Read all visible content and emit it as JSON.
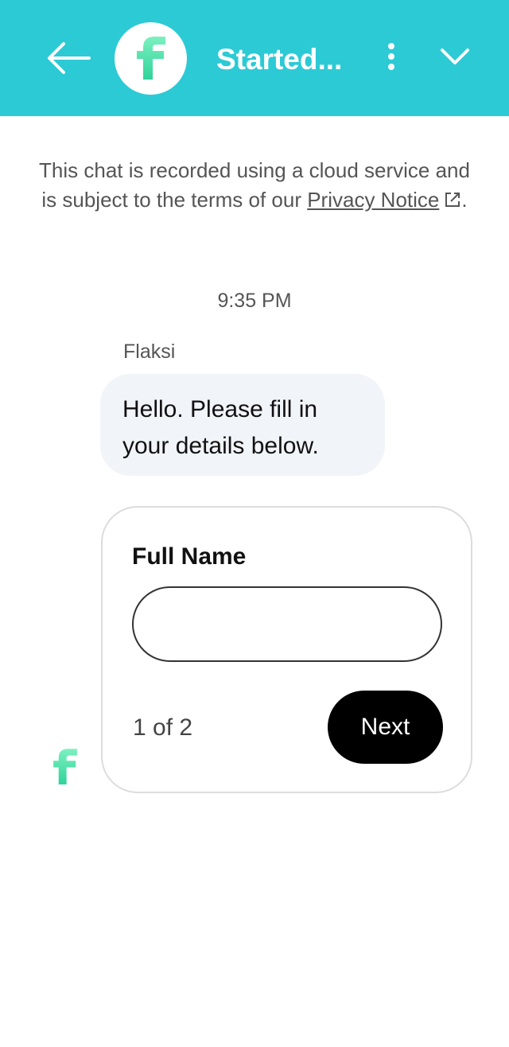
{
  "header": {
    "title": "Started...",
    "back_icon": "arrow-left-icon",
    "more_icon": "more-vertical-icon",
    "collapse_icon": "chevron-down-icon",
    "brand_color": "#2ccad5",
    "logo_colors": [
      "#7df0c0",
      "#2fd39a"
    ]
  },
  "privacy": {
    "text_before": "This chat is recorded using a cloud service and is subject to the terms of our ",
    "link_text": "Privacy Notice",
    "text_after": ".",
    "link_icon": "external-link-icon"
  },
  "conversation": {
    "timestamp": "9:35 PM",
    "sender": "Flaksi",
    "message": "Hello. Please fill in your details below."
  },
  "form": {
    "label": "Full Name",
    "value": "",
    "placeholder": "",
    "step": "1 of 2",
    "next_label": "Next"
  }
}
